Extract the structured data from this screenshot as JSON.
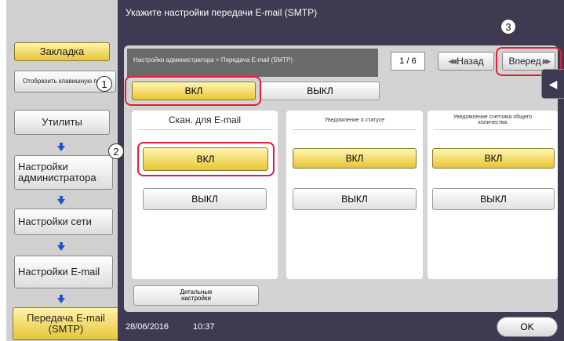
{
  "sidebar": {
    "bookmark": "Закладка",
    "show_keypad": "Отобразить клавишную пане",
    "utilities": "Утилиты",
    "admin_settings": "Настройки администратора",
    "network_settings": "Настройки сети",
    "email_settings": "Настройки E-mail",
    "smtp_transfer": "Передача E-mail (SMTP)"
  },
  "header": {
    "title": "Укажите настройки передачи E-mail (SMTP)",
    "breadcrumb": "Настройки администратора > Передача E-mail (SMTP)",
    "page": "1 / 6",
    "back": "Назад",
    "next": "Вперед"
  },
  "main_toggle": {
    "on": "ВКЛ",
    "off": "ВЫКЛ"
  },
  "columns": [
    {
      "title": "Скан. для E-mail",
      "on": "ВКЛ",
      "off": "ВЫКЛ"
    },
    {
      "title": "Уведомление о статусе",
      "on": "ВКЛ",
      "off": "ВЫКЛ"
    },
    {
      "title": "Уведомление счетчика общего количества",
      "on": "ВКЛ",
      "off": "ВЫКЛ"
    }
  ],
  "detail_settings": "Детальные настройки",
  "callouts": [
    "1",
    "2",
    "3"
  ],
  "footer": {
    "date": "28/06/2016",
    "time": "10:37",
    "ok": "OK"
  },
  "colors": {
    "highlight_ring": "#e0203a",
    "selected": "#e8c535",
    "panel": "#3e3a52"
  }
}
